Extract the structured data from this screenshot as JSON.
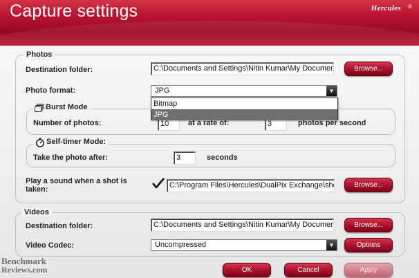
{
  "window": {
    "title": "Capture settings",
    "brand": "Hercules",
    "brand_mark": "®"
  },
  "photos": {
    "group_title": "Photos",
    "destination_label": "Destination folder:",
    "destination_value": "C:\\Documents and Settings\\Nitin Kumar\\My Documen",
    "browse_label": "Browse...",
    "format_label": "Photo format:",
    "format_value": "JPG",
    "format_options": [
      "Bitmap",
      "JPG"
    ],
    "burst": {
      "title": "Burst Mode",
      "count_label": "Number of photos:",
      "count_value": "10",
      "rate_label": "at a rate of:",
      "rate_value": "3",
      "rate_suffix": "photos per second"
    },
    "timer": {
      "title": "Self-timer Mode:",
      "label": "Take the photo after:",
      "value": "3",
      "suffix": "seconds"
    },
    "sound": {
      "label_line1": "Play a sound when a shot is",
      "label_line2": "taken:",
      "checked": true,
      "path_value": "C:\\Program Files\\Hercules\\DualPix Exchange\\sho",
      "browse_label": "Browse..."
    }
  },
  "videos": {
    "group_title": "Videos",
    "destination_label": "Destination folder:",
    "destination_value": "C:\\Documents and Settings\\Nitin Kumar\\My Documen",
    "browse_label": "Browse...",
    "codec_label": "Video Codec:",
    "codec_value": "Uncompressed",
    "options_label": "Options"
  },
  "footer": {
    "ok_label": "OK",
    "cancel_label": "Cancel",
    "apply_label": "Apply"
  },
  "watermark": {
    "line1": "Benchmark",
    "line2": "Reviews.com"
  },
  "colors": {
    "header_red": "#b8142f",
    "button_red": "#a5102a",
    "panel_bg": "#ececec"
  },
  "icons": {
    "burst": "stack-photos-icon",
    "timer": "stopwatch-icon",
    "checkbox": "checkmark-icon",
    "dropdown": "chevron-down-icon"
  }
}
